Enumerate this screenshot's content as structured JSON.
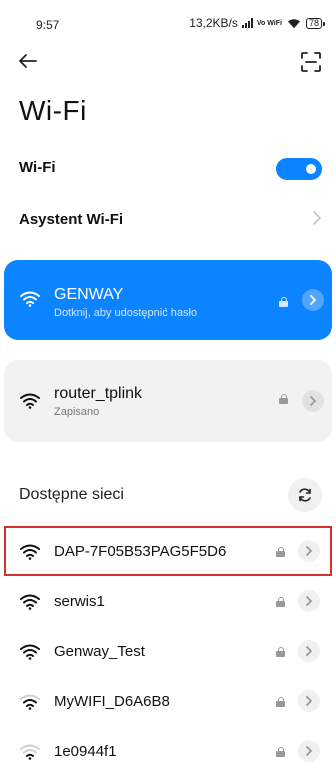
{
  "status_bar": {
    "time": "9:57",
    "speed": "13,2KB/s",
    "volte": "Vo WiFi",
    "battery": "78"
  },
  "header": {
    "back_icon": "arrow-left-icon",
    "scan_icon": "qr-scan-icon",
    "title": "Wi-Fi"
  },
  "wifi_toggle": {
    "label": "Wi-Fi",
    "enabled": true,
    "accent": "#0d84ff"
  },
  "assistant": {
    "label": "Asystent Wi-Fi"
  },
  "connected_network": {
    "ssid": "GENWAY",
    "subtitle": "Dotknij, aby udostępnić hasło",
    "background": "#0d84ff"
  },
  "saved_network": {
    "ssid": "router_tplink",
    "subtitle": "Zapisano"
  },
  "available": {
    "title": "Dostępne sieci",
    "refresh_icon": "refresh-icon",
    "networks": [
      {
        "ssid": "DAP-7F05B53PAG5F5D6",
        "signal": 4,
        "highlighted": true
      },
      {
        "ssid": "serwis1",
        "signal": 4
      },
      {
        "ssid": "Genway_Test",
        "signal": 4
      },
      {
        "ssid": "MyWIFI_D6A6B8",
        "signal": 3
      },
      {
        "ssid": "1e0944f1",
        "signal": 2
      }
    ]
  },
  "highlight_color": "#d32f2f"
}
